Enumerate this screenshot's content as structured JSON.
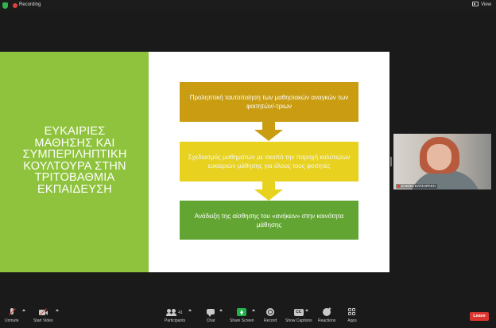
{
  "topbar": {
    "recording_label": "Recording",
    "view_label": "View"
  },
  "slide": {
    "title": "ΕΥΚΑΙΡΙΕΣ\nΜΑΘΗΣΗΣ ΚΑΙ\nΣΥΜΠΕΡΙΛΗΠΤΙΚΗ\nΚΟΥΛΤΟΥΡΑ ΣΤΗΝ\nΤΡΙΤΟΒΑΘΜΙΑ\nΕΚΠΑΙΔΕΥΣΗ",
    "steps": [
      {
        "text": "Προληπτική ταυτοποίηση των μαθησιακών αναγκών των φοιτητών/-τριων",
        "color": "#c99c11"
      },
      {
        "text": "Σχεδιασμός μαθημάτων με σκοπό την παροχή καλύτερων ευκαιριών μάθησης για όλους τους φοιτητές",
        "color": "#e8d21f"
      },
      {
        "text": "Ανάδειξη της αίσθησης του «ανήκειν» στην κοινότητα μάθησης",
        "color": "#62a532"
      }
    ],
    "left_panel_color": "#8fc33e"
  },
  "video": {
    "participant_name": "ΕΛΕΝΗ ΚΑΤΣΑΡΑΚΗ"
  },
  "toolbar": {
    "unmute": "Unmute",
    "start_video": "Start Video",
    "participants": "Participants",
    "participants_count": "41",
    "chat": "Chat",
    "share_screen": "Share Screen",
    "record": "Record",
    "show_captions": "Show Captions",
    "captions_icon_text": "CC",
    "reactions": "Reactions",
    "apps": "Apps",
    "leave": "Leave"
  },
  "colors": {
    "leave": "#d9352f",
    "share": "#22b14c",
    "recording": "#e0413a"
  }
}
